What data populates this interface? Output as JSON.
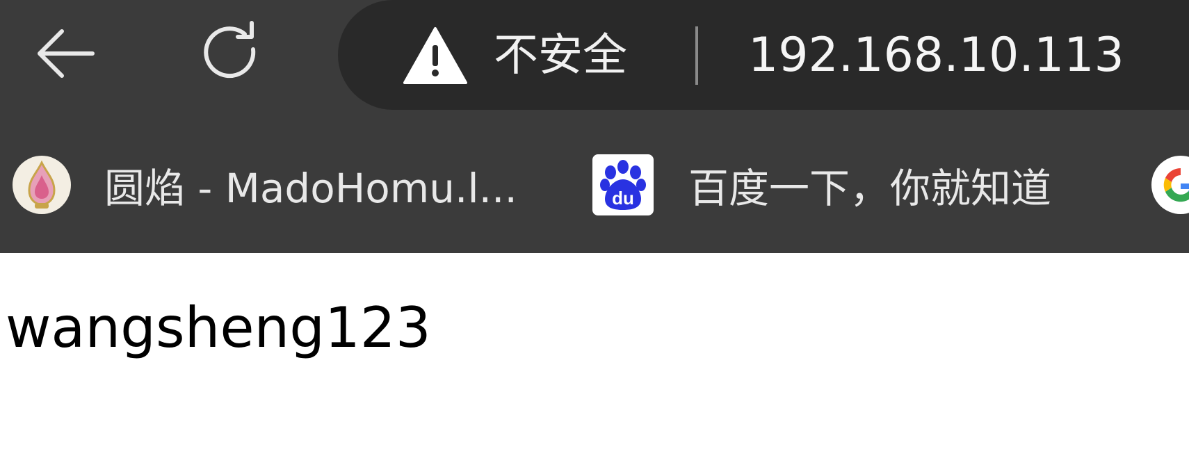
{
  "toolbar": {
    "back_icon": "arrow-left-icon",
    "reload_icon": "reload-icon",
    "security": {
      "icon": "warning-icon",
      "label": "不安全"
    },
    "url": "192.168.10.113"
  },
  "bookmarks": [
    {
      "icon": "madohomu-favicon",
      "label": "圆焰 - MadoHomu.l..."
    },
    {
      "icon": "baidu-favicon",
      "label": "百度一下，你就知道"
    },
    {
      "icon": "google-favicon",
      "label": ""
    }
  ],
  "page": {
    "text": "wangsheng123"
  },
  "colors": {
    "toolbar_bg": "#3b3b3b",
    "omnibox_bg": "#292929",
    "baidu_blue": "#2932e1"
  }
}
